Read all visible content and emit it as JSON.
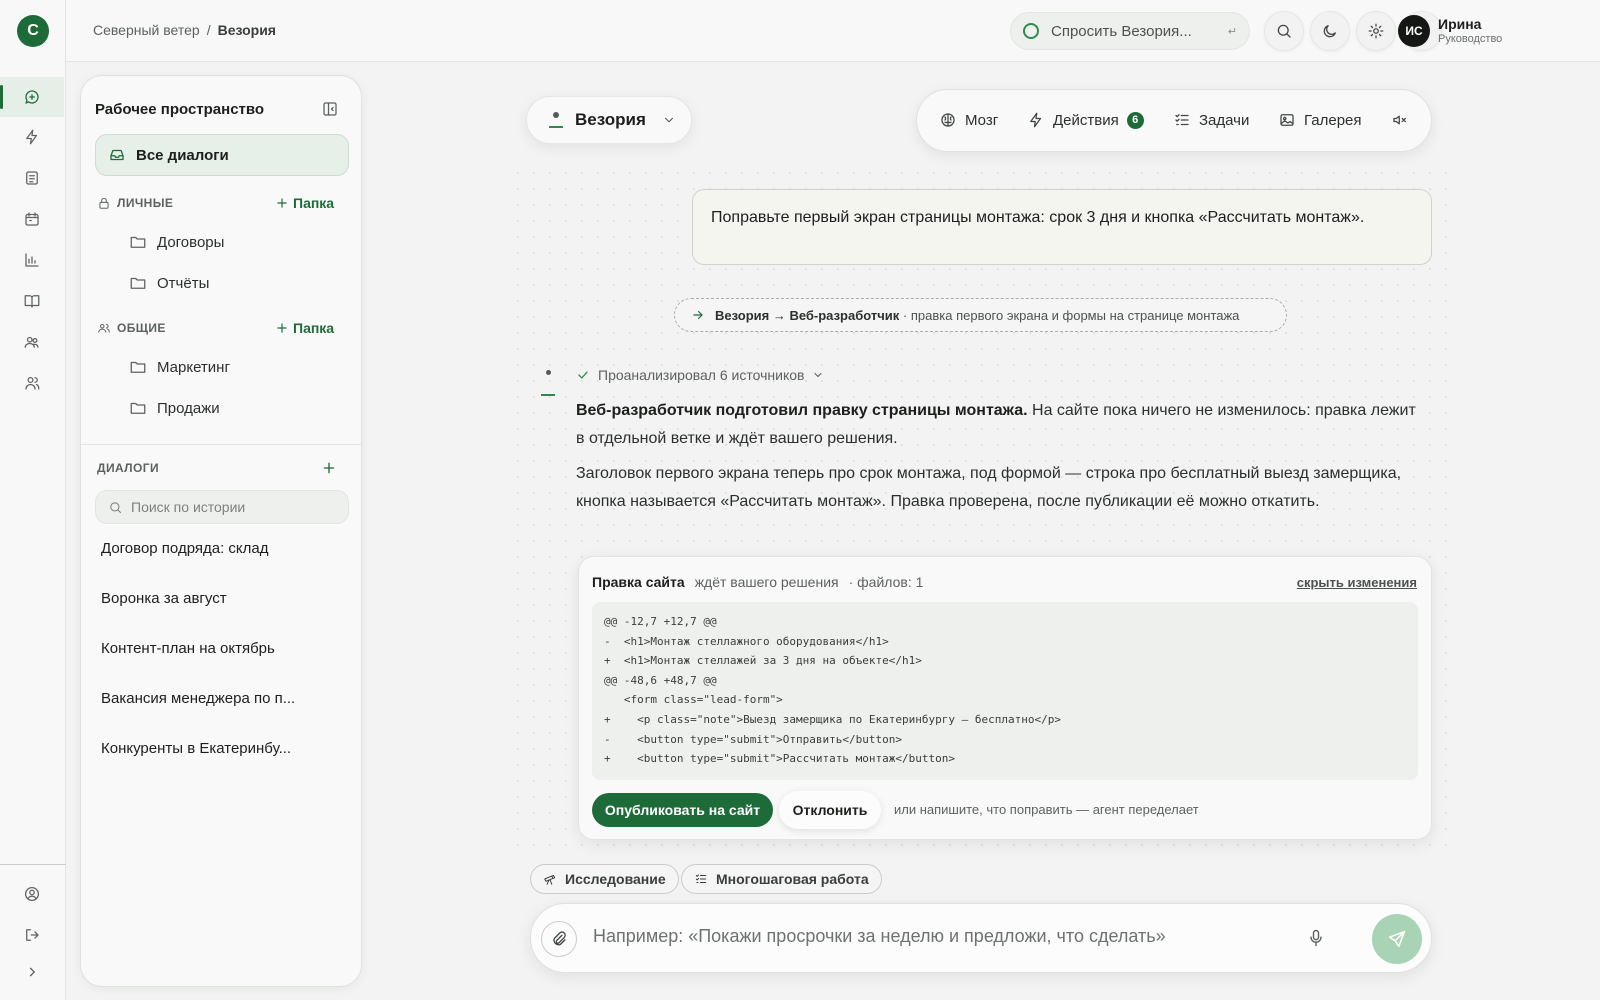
{
  "brand": {
    "logo_letter": "С",
    "accent": "#1e6b3a",
    "accent_light": "#a8d3b4"
  },
  "rail": {
    "items": [
      {
        "icon": "chat-icon",
        "active": true
      },
      {
        "icon": "lightning-icon"
      },
      {
        "icon": "document-icon"
      },
      {
        "icon": "calendar-icon"
      },
      {
        "icon": "bar-chart-icon"
      },
      {
        "icon": "book-icon"
      },
      {
        "icon": "users-icon"
      },
      {
        "icon": "team-icon"
      }
    ],
    "bottom": [
      {
        "icon": "profile-icon"
      },
      {
        "icon": "logout-icon"
      },
      {
        "icon": "chevron-right-icon"
      }
    ]
  },
  "header": {
    "breadcrumb": {
      "org": "Северный ветер",
      "sep": "/",
      "current": "Везория"
    },
    "ask": {
      "placeholder": "Спросить Везория...",
      "hint": "↵"
    },
    "user": {
      "initials": "ИС",
      "name": "Ирина",
      "role": "Руководство"
    }
  },
  "workspace": {
    "title": "Рабочее пространство",
    "all_dialogs": "Все диалоги",
    "personal": {
      "label": "ЛИЧНЫЕ",
      "add": "Папка",
      "folders": [
        "Договоры",
        "Отчёты"
      ]
    },
    "shared": {
      "label": "ОБЩИЕ",
      "add": "Папка",
      "folders": [
        "Маркетинг",
        "Продажи"
      ]
    },
    "dialogs": {
      "label": "ДИАЛОГИ",
      "search_placeholder": "Поиск по истории",
      "items": [
        "Договор подряда: склад",
        "Воронка за август",
        "Контент-план на октябрь",
        "Вакансия менеджера по п...",
        "Конкуренты в Екатеринбу..."
      ]
    }
  },
  "agent": {
    "name": "Везория"
  },
  "tools": {
    "brain": "Мозг",
    "actions": "Действия",
    "actions_count": "6",
    "tasks": "Задачи",
    "gallery": "Галерея"
  },
  "chat": {
    "user_message": "Поправьте первый экран страницы монтажа: срок 3 дня и кнопка «Рассчитать монтаж».",
    "handoff": {
      "route": "Везория → Веб-разработчик",
      "detail": "· правка первого экрана и формы на странице монтажа"
    },
    "analyzed": "Проанализировал 6 источников",
    "reply_bold": "Веб-разработчик подготовил правку страницы монтажа.",
    "reply_rest": " На сайте пока ничего не изменилось: правка лежит в отдельной ветке и ждёт вашего решения.",
    "reply_p2": "Заголовок первого экрана теперь про срок монтажа, под формой — строка про бесплатный выезд замерщика, кнопка называется «Рассчитать монтаж». Правка проверена, после публикации её можно откатить.",
    "edit": {
      "title": "Правка сайта",
      "status": "ждёт вашего решения",
      "files": "· файлов: 1",
      "hide": "скрыть изменения",
      "diff": [
        "@@ -12,7 +12,7 @@",
        "-  <h1>Монтаж стеллажного оборудования</h1>",
        "+  <h1>Монтаж стеллажей за 3 дня на объекте</h1>",
        "@@ -48,6 +48,7 @@",
        "   <form class=\"lead-form\">",
        "+    <p class=\"note\">Выезд замерщика по Екатеринбургу — бесплатно</p>",
        "-    <button type=\"submit\">Отправить</button>",
        "+    <button type=\"submit\">Рассчитать монтаж</button>"
      ],
      "publish": "Опубликовать на сайт",
      "reject": "Отклонить",
      "hint": "или напишите, что поправить — агент переделает"
    }
  },
  "modes": {
    "research": "Исследование",
    "multistep": "Многошаговая работа"
  },
  "composer": {
    "placeholder": "Например: «Покажи просрочки за неделю и предложи, что сделать»"
  }
}
